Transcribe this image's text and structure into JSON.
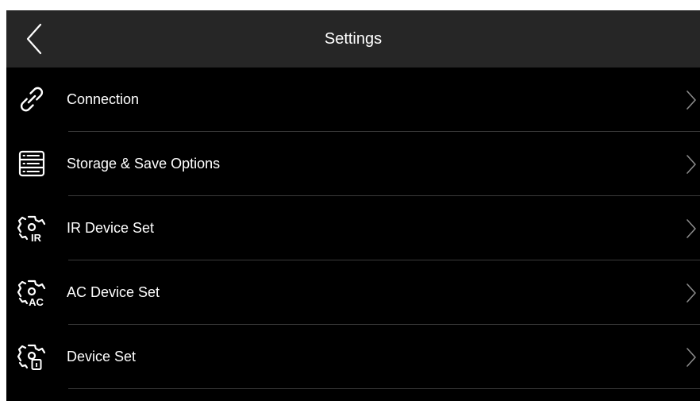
{
  "header": {
    "title": "Settings",
    "back_icon": "chevron-left-icon",
    "background": "#262626"
  },
  "theme": {
    "background": "#000000",
    "text": "#ffffff",
    "chevron": "#8a8a8a",
    "divider": "#3a3a3a"
  },
  "items": [
    {
      "label": "Connection",
      "icon": "link-icon"
    },
    {
      "label": "Storage & Save Options",
      "icon": "storage-icon"
    },
    {
      "label": "IR Device Set",
      "icon": "gear-icon",
      "icon_badge": "IR"
    },
    {
      "label": "AC Device Set",
      "icon": "gear-icon",
      "icon_badge": "AC"
    },
    {
      "label": "Device Set",
      "icon": "gear-icon"
    }
  ]
}
